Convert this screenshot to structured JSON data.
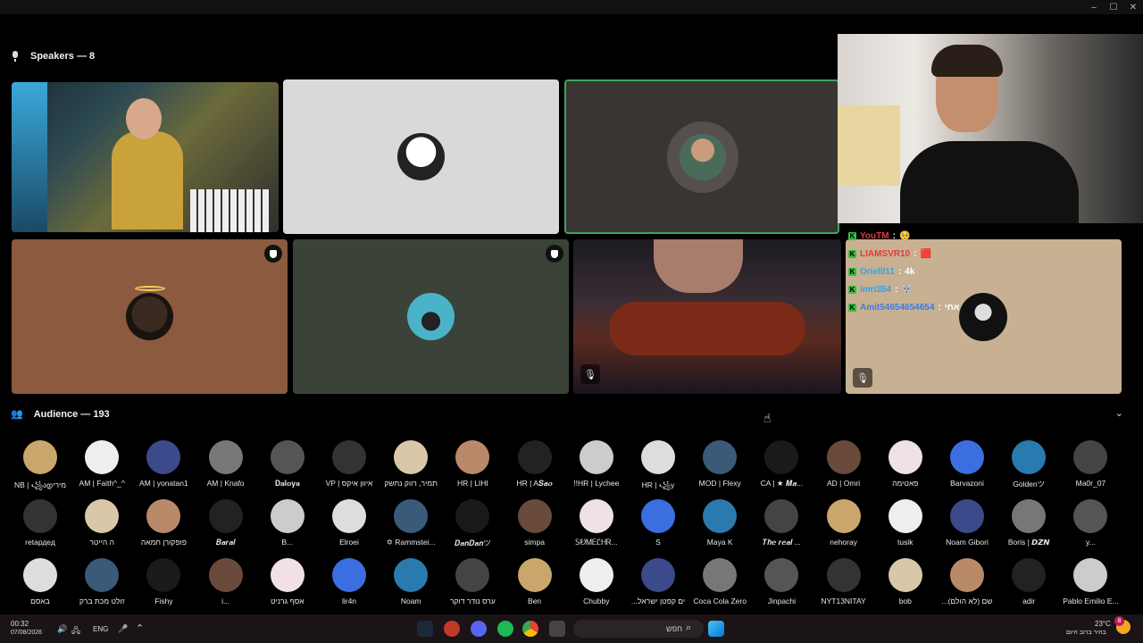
{
  "window": {
    "min": "–",
    "max": "☐",
    "close": "✕"
  },
  "speakers": {
    "label": "Speakers — 8"
  },
  "audience": {
    "label": "Audience — 193",
    "rows": [
      [
        "NB | ꧁ადמירי",
        "AM | Faith^_^",
        "AM | yonatan1",
        "AM | Knafo",
        "𝐃𝐚𝐥𝐨𝐲𝐚",
        "VP | איוון איקס",
        "תמיר, רווק נחשק",
        "HR | LIHI",
        "HR | A𝑺𝒂𝒐",
        "!!HR | Lychee",
        "HR | ꧁y",
        "MOD | Flexy",
        "CA | ★ 𝑴𝒂...",
        "AD | Omri",
        "פאטימה",
        "Barvazoni",
        "Goldenツ",
        "Ma0r_07"
      ],
      [
        "retардед",
        "ה הייטר",
        "פופקורן חמאה",
        "𝑩𝒂𝒓𝒂𝒍",
        "B...",
        "Elroei",
        "✡ Rammstei...",
        "𝑫𝒂𝒏𝑫𝒂𝒏ツ",
        "simpa",
        "ᏚᎧᎷᎬᏝᎻᏒ...",
        "S",
        "Maya K",
        "𝑻𝒉𝒆 𝒓𝒆𝒂𝒍 ...",
        "nehoray",
        "tusik",
        "Noam Gibori",
        "Boris | 𝘿𝙕𝙉",
        "y..."
      ],
      [
        "באסם",
        "זולט מכת ברק",
        "Fishy",
        "i...",
        "אסף גרניט",
        "lir4n",
        "Noam",
        "ערס נודר דוקר",
        "Ben",
        "Chubby",
        "...ים קפטן ישראל",
        "Coca Cola Zero",
        "Jinpachi",
        "NYT13NITAY",
        "bob",
        "...שם (לא הולם)",
        "adir",
        "Pablo Emilio E..."
      ]
    ]
  },
  "chat": [
    {
      "user": "YouTM",
      "msg": "🥺",
      "color": "#e03c3c"
    },
    {
      "user": "LIAMSVR10",
      "msg": "🟥",
      "color": "#e03c3c"
    },
    {
      "user": "Orielll11",
      "msg": "4k",
      "color": "#2fa4e7"
    },
    {
      "user": "imri354",
      "msg": "🐺",
      "color": "#2fa4e7"
    },
    {
      "user": "Amit54654654654",
      "msg": "אחי",
      "color": "#3d7be0"
    }
  ],
  "taskbar": {
    "time": "00:32",
    "date": "07/08/2026",
    "lang": "ENG",
    "search_placeholder": "חפש",
    "weather_temp": "23°C",
    "weather_desc": "בהיר ברוב היום",
    "notif_count": "8"
  },
  "colors": {
    "brown_tile": "#8b5a3f",
    "green_tile": "#3b4339",
    "gray_tile": "#d9d9d9",
    "dark_tile": "#3a3533",
    "chat_tile": "#c8b092",
    "active_border": "#3ba55c"
  }
}
